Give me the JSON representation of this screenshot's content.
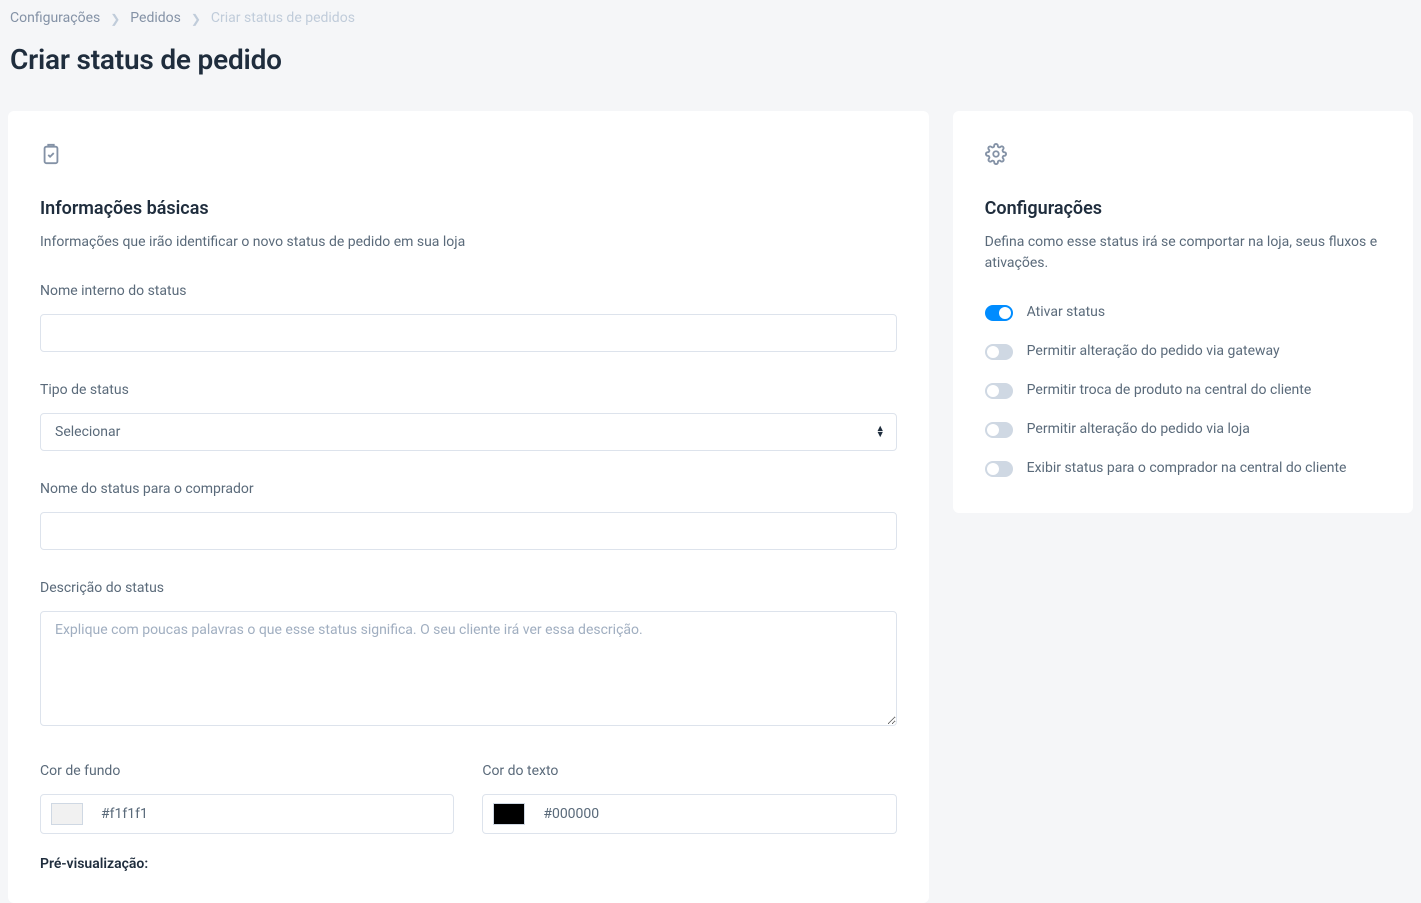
{
  "breadcrumb": {
    "item1": "Configurações",
    "item2": "Pedidos",
    "current": "Criar status de pedidos"
  },
  "page_title": "Criar status de pedido",
  "main": {
    "section_title": "Informações básicas",
    "section_desc": "Informações que irão identificar o novo status de pedido em sua loja",
    "labels": {
      "internal_name": "Nome interno do status",
      "status_type": "Tipo de status",
      "buyer_name": "Nome do status para o comprador",
      "description": "Descrição do status",
      "bg_color": "Cor de fundo",
      "text_color": "Cor do texto",
      "preview": "Pré-visualização:"
    },
    "select_placeholder": "Selecionar",
    "description_placeholder": "Explique com poucas palavras o que esse status significa. O seu cliente irá ver essa descrição.",
    "values": {
      "internal_name": "",
      "buyer_name": "",
      "description": "",
      "bg_color": "#f1f1f1",
      "text_color": "#000000"
    }
  },
  "side": {
    "section_title": "Configurações",
    "section_desc": "Defina como esse status irá se comportar na loja, seus fluxos e ativações.",
    "toggles": {
      "activate": {
        "label": "Ativar status",
        "on": true
      },
      "alter_gateway": {
        "label": "Permitir alteração do pedido via gateway",
        "on": false
      },
      "exchange_product": {
        "label": "Permitir troca de produto na central do cliente",
        "on": false
      },
      "alter_store": {
        "label": "Permitir alteração do pedido via loja",
        "on": false
      },
      "show_buyer": {
        "label": "Exibir status para o comprador na central do cliente",
        "on": false
      }
    }
  }
}
